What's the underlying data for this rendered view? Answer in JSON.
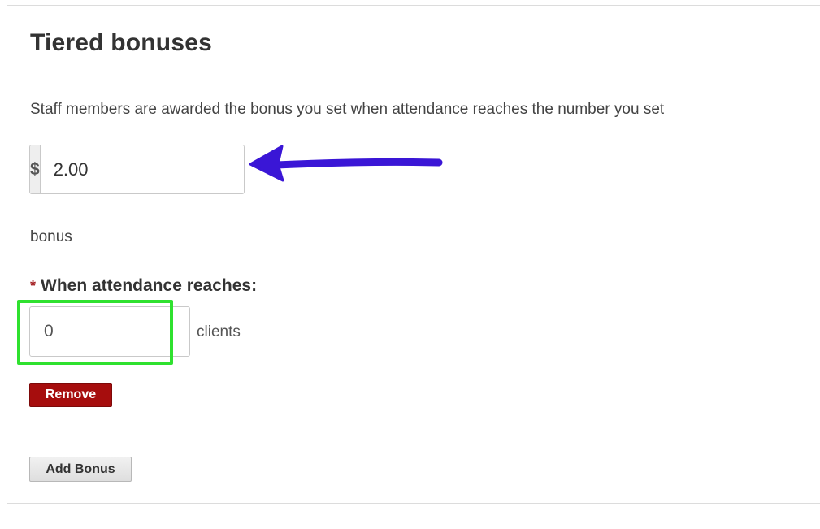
{
  "section": {
    "title": "Tiered bonuses",
    "description": "Staff members are awarded the bonus you set when attendance reaches the number you set"
  },
  "bonus": {
    "currency_symbol": "$",
    "amount_value": "2.00",
    "label": "bonus"
  },
  "attendance": {
    "required_marker": "*",
    "label": "When attendance reaches:",
    "value": "0",
    "unit": "clients"
  },
  "buttons": {
    "remove_label": "Remove",
    "add_bonus_label": "Add Bonus"
  },
  "annotations": {
    "arrow_color": "#3a16d6",
    "highlight_color": "#2fe12f"
  },
  "colors": {
    "remove_button": "#a60d0d",
    "required_star": "#a31e22"
  }
}
